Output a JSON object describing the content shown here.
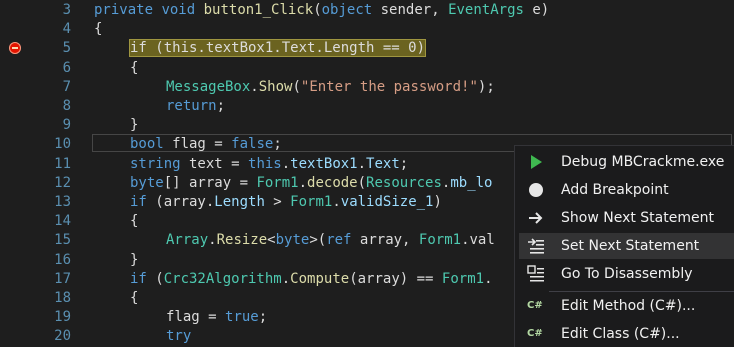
{
  "editor": {
    "lines": [
      {
        "num": "3",
        "tokens": [
          {
            "t": "private",
            "c": "kw"
          },
          {
            "t": " "
          },
          {
            "t": "void",
            "c": "kw"
          },
          {
            "t": " "
          },
          {
            "t": "button1_Click",
            "c": "me"
          },
          {
            "t": "("
          },
          {
            "t": "object",
            "c": "kw"
          },
          {
            "t": " sender, "
          },
          {
            "t": "EventArgs",
            "c": "ty"
          },
          {
            "t": " e)"
          }
        ]
      },
      {
        "num": "4",
        "tokens": [
          {
            "t": "{"
          }
        ]
      },
      {
        "num": "5",
        "tokens": [
          {
            "t": "if (this.textBox1.Text.Length == 0)",
            "c": "hl"
          }
        ]
      },
      {
        "num": "6",
        "tokens": [
          {
            "t": "{"
          }
        ]
      },
      {
        "num": "7",
        "tokens": [
          {
            "t": "MessageBox",
            "c": "ty"
          },
          {
            "t": "."
          },
          {
            "t": "Show",
            "c": "me"
          },
          {
            "t": "("
          },
          {
            "t": "\"Enter the password!\"",
            "c": "st"
          },
          {
            "t": ");"
          }
        ]
      },
      {
        "num": "8",
        "tokens": [
          {
            "t": "return",
            "c": "kw"
          },
          {
            "t": ";"
          }
        ]
      },
      {
        "num": "9",
        "tokens": [
          {
            "t": "}"
          }
        ]
      },
      {
        "num": "10",
        "tokens": [
          {
            "t": "bool",
            "c": "kw"
          },
          {
            "t": " flag = "
          },
          {
            "t": "false",
            "c": "kw"
          },
          {
            "t": ";"
          }
        ]
      },
      {
        "num": "11",
        "tokens": [
          {
            "t": "string",
            "c": "kw"
          },
          {
            "t": " text = "
          },
          {
            "t": "this",
            "c": "kw"
          },
          {
            "t": "."
          },
          {
            "t": "textBox1",
            "c": "pr"
          },
          {
            "t": "."
          },
          {
            "t": "Text",
            "c": "pr"
          },
          {
            "t": ";"
          }
        ]
      },
      {
        "num": "12",
        "tokens": [
          {
            "t": "byte",
            "c": "kw"
          },
          {
            "t": "[] array = "
          },
          {
            "t": "Form1",
            "c": "ty"
          },
          {
            "t": "."
          },
          {
            "t": "decode",
            "c": "me"
          },
          {
            "t": "("
          },
          {
            "t": "Resources",
            "c": "ty"
          },
          {
            "t": "."
          },
          {
            "t": "mb_lo",
            "c": "pr"
          }
        ]
      },
      {
        "num": "13",
        "tokens": [
          {
            "t": "if",
            "c": "kw"
          },
          {
            "t": " (array."
          },
          {
            "t": "Length",
            "c": "pr"
          },
          {
            "t": " > "
          },
          {
            "t": "Form1",
            "c": "ty"
          },
          {
            "t": "."
          },
          {
            "t": "validSize_1",
            "c": "pr"
          },
          {
            "t": ")"
          }
        ]
      },
      {
        "num": "14",
        "tokens": [
          {
            "t": "{"
          }
        ]
      },
      {
        "num": "15",
        "tokens": [
          {
            "t": "Array",
            "c": "ty"
          },
          {
            "t": "."
          },
          {
            "t": "Resize",
            "c": "me"
          },
          {
            "t": "<"
          },
          {
            "t": "byte",
            "c": "kw"
          },
          {
            "t": ">("
          },
          {
            "t": "ref",
            "c": "kw"
          },
          {
            "t": " array, "
          },
          {
            "t": "Form1",
            "c": "ty"
          },
          {
            "t": ".val"
          }
        ]
      },
      {
        "num": "16",
        "tokens": [
          {
            "t": "}"
          }
        ]
      },
      {
        "num": "17",
        "tokens": [
          {
            "t": "if",
            "c": "kw"
          },
          {
            "t": " ("
          },
          {
            "t": "Crc32Algorithm",
            "c": "ty"
          },
          {
            "t": "."
          },
          {
            "t": "Compute",
            "c": "me"
          },
          {
            "t": "(array) == "
          },
          {
            "t": "Form1",
            "c": "ty"
          },
          {
            "t": "."
          }
        ]
      },
      {
        "num": "18",
        "tokens": [
          {
            "t": "{"
          }
        ]
      },
      {
        "num": "19",
        "tokens": [
          {
            "t": "flag = "
          },
          {
            "t": "true",
            "c": "kw"
          },
          {
            "t": ";"
          }
        ]
      },
      {
        "num": "20",
        "tokens": [
          {
            "t": "try",
            "c": "kw"
          }
        ]
      }
    ]
  },
  "context_menu": {
    "items": [
      {
        "label": "Debug MBCrackme.exe",
        "icon": "play-icon"
      },
      {
        "label": "Add Breakpoint",
        "icon": "breakpoint-icon"
      },
      {
        "label": "Show Next Statement",
        "icon": "arrow-right-icon"
      },
      {
        "label": "Set Next Statement",
        "icon": "set-next-statement-icon"
      },
      {
        "label": "Go To Disassembly",
        "icon": "disassembly-icon"
      },
      {
        "label": "Edit Method (C#)...",
        "icon": "csharp-icon"
      },
      {
        "label": "Edit Class (C#)...",
        "icon": "csharp-icon"
      }
    ],
    "csharp_glyph": "C#"
  },
  "colors": {
    "background": "#1e1e1e",
    "keyword": "#569cd6",
    "type": "#4ec9b0",
    "method": "#dcdcaa",
    "string": "#d69d85",
    "breakpoint": "#e51400",
    "play": "#3fb950"
  }
}
